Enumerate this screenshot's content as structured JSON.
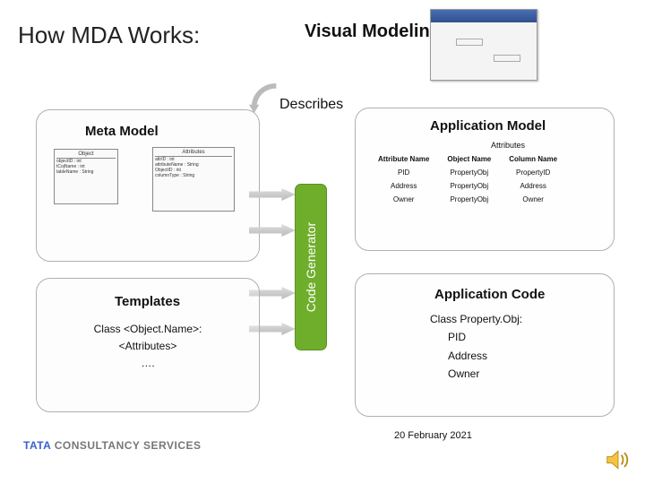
{
  "title": "How MDA Works:",
  "visual_label": "Visual Modeling",
  "describes": "Describes",
  "meta_model": {
    "label": "Meta Model"
  },
  "app_model": {
    "label": "Application Model",
    "attributes_title": "Attributes",
    "headers": [
      "Attribute Name",
      "Object Name",
      "Column Name"
    ],
    "rows": [
      [
        "PID",
        "PropertyObj",
        "PropertyID"
      ],
      [
        "Address",
        "PropertyObj",
        "Address"
      ],
      [
        "Owner",
        "PropertyObj",
        "Owner"
      ]
    ]
  },
  "uml": {
    "object": {
      "title": "Object",
      "attrs": [
        "objectID : int",
        "tCojName : int",
        "tableName : String"
      ]
    },
    "attribute": {
      "title": "Attributes",
      "attrs": [
        "attrID : int",
        "attributeName : String",
        "ObjectID : int",
        "columnType : String"
      ]
    }
  },
  "code_generator": "Code Generator",
  "templates": {
    "label": "Templates",
    "line1": "Class <Object.Name>:",
    "line2": "<Attributes>",
    "line3": "…."
  },
  "app_code": {
    "label": "Application Code",
    "line1": "Class Property.Obj:",
    "items": [
      "PID",
      "Address",
      "Owner"
    ]
  },
  "footer": {
    "date": "20 February 2021",
    "logo1": "TATA",
    "logo2": "CONSULTANCY SERVICES",
    "bg": "TATATATATATATATATATATATATATATATATATATATATATATA"
  }
}
